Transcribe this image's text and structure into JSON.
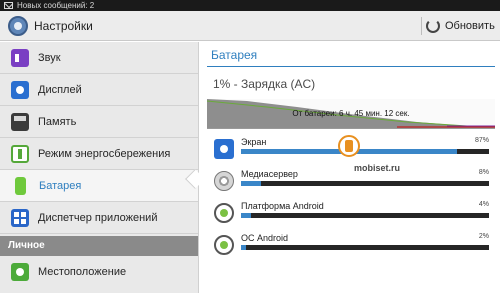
{
  "status_bar": {
    "message": "Новых сообщений: 2"
  },
  "action_bar": {
    "title": "Настройки",
    "refresh_label": "Обновить"
  },
  "sidebar": {
    "items": [
      {
        "label": "Звук",
        "icon": "sound-icon"
      },
      {
        "label": "Дисплей",
        "icon": "display-icon"
      },
      {
        "label": "Память",
        "icon": "memory-card-icon"
      },
      {
        "label": "Режим энергосбережения",
        "icon": "power-saving-icon"
      },
      {
        "label": "Батарея",
        "icon": "battery-icon",
        "selected": true
      },
      {
        "label": "Диспетчер приложений",
        "icon": "apps-grid-icon"
      }
    ],
    "section_personal": "Личное",
    "personal_items": [
      {
        "label": "Местоположение",
        "icon": "location-icon"
      }
    ]
  },
  "battery": {
    "title": "Батарея",
    "charge_status": "1% - Зарядка (AC)",
    "graph_label": "От батареи: 6 ч. 45 мин. 12 сек.",
    "usage": [
      {
        "name": "Экран",
        "percent_label": "87%",
        "percent": 87,
        "icon": "screen-icon"
      },
      {
        "name": "Медиасервер",
        "percent_label": "8%",
        "percent": 8,
        "icon": "mediaserver-icon"
      },
      {
        "name": "Платформа Android",
        "percent_label": "4%",
        "percent": 4,
        "icon": "android-platform-icon"
      },
      {
        "name": "ОС Android",
        "percent_label": "2%",
        "percent": 2,
        "icon": "android-os-icon"
      }
    ]
  },
  "watermark": {
    "text": "mobiset.ru"
  },
  "colors": {
    "accent": "#2f7fbf",
    "bar_fill": "#3a86c8",
    "bar_track": "#262626",
    "sidebar_bg": "#e9e9e9"
  }
}
